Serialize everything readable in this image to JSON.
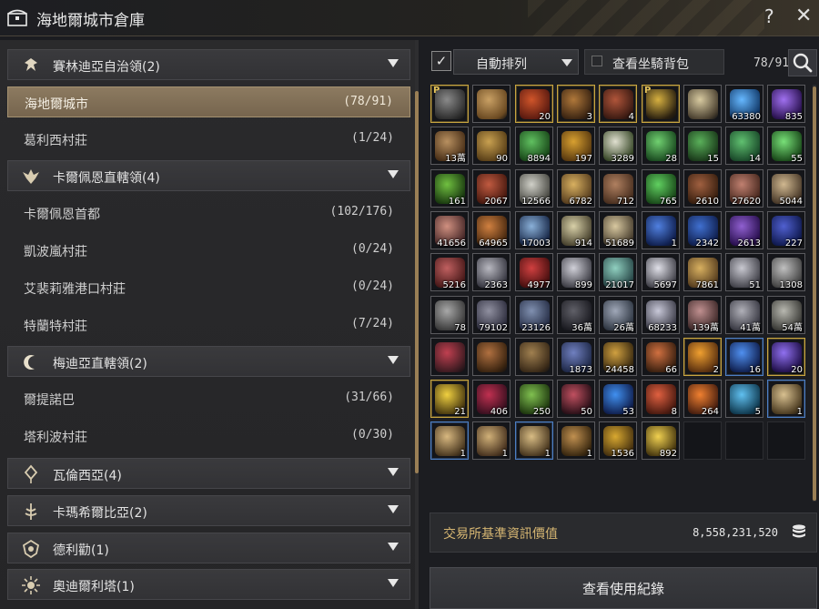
{
  "window": {
    "title": "海地爾城市倉庫",
    "help_label": "?",
    "close_label": "✕"
  },
  "left": {
    "rows": [
      {
        "kind": "region",
        "label": "賽林迪亞自治領(2)",
        "icon": "eagle-emblem-icon"
      },
      {
        "kind": "town",
        "label": "海地爾城市",
        "count": "(78/91)",
        "selected": true
      },
      {
        "kind": "town",
        "label": "葛利西村莊",
        "count": "(1/24)"
      },
      {
        "kind": "region",
        "label": "卡爾佩恩直轄領(4)",
        "icon": "winged-crest-icon"
      },
      {
        "kind": "town",
        "label": "卡爾佩恩首都",
        "count": "(102/176)"
      },
      {
        "kind": "town",
        "label": "凱波嵐村莊",
        "count": "(0/24)"
      },
      {
        "kind": "town",
        "label": "艾裴莉雅港口村莊",
        "count": "(0/24)"
      },
      {
        "kind": "town",
        "label": "特蘭特村莊",
        "count": "(7/24)"
      },
      {
        "kind": "region",
        "label": "梅迪亞直轄領(2)",
        "icon": "crescent-moon-icon"
      },
      {
        "kind": "town",
        "label": "爾提諾巴",
        "count": "(31/66)"
      },
      {
        "kind": "town",
        "label": "塔利波村莊",
        "count": "(0/30)"
      },
      {
        "kind": "region",
        "label": "瓦倫西亞(4)",
        "icon": "diamond-crest-icon"
      },
      {
        "kind": "region",
        "label": "卡瑪希爾比亞(2)",
        "icon": "tree-crest-icon"
      },
      {
        "kind": "region",
        "label": "德利勸(1)",
        "icon": "shield-crest-icon"
      },
      {
        "kind": "region",
        "label": "奧迪爾利塔(1)",
        "icon": "sun-crest-icon"
      }
    ]
  },
  "right": {
    "sort_checked": "✓",
    "sort_label": "自動排列",
    "mount_label": "查看坐騎背包",
    "capacity": "78/91",
    "grid_columns": 9,
    "grid_rows": 10,
    "items": [
      {
        "name": "grapple-hook-item",
        "count": "",
        "q": "gold",
        "c1": "#8a8a8a",
        "c2": "#2c2c2c",
        "p": "P"
      },
      {
        "name": "ornate-sphere-item",
        "count": "",
        "q": "",
        "c1": "#c9a064",
        "c2": "#6b4a22"
      },
      {
        "name": "red-figurine-item",
        "count": "20",
        "q": "gold",
        "c1": "#d0552a",
        "c2": "#5a1a10"
      },
      {
        "name": "bronze-cauldron-item",
        "count": "3",
        "q": "gold",
        "c1": "#b0783a",
        "c2": "#3a2412"
      },
      {
        "name": "red-cauldron-item",
        "count": "4",
        "q": "gold",
        "c1": "#b0553a",
        "c2": "#3a1a12"
      },
      {
        "name": "gold-chandelier-item",
        "count": "",
        "q": "gold",
        "c1": "#d6b040",
        "c2": "#2a2010",
        "p": "P"
      },
      {
        "name": "paper-bundle-item",
        "count": "",
        "q": "",
        "c1": "#d8caa0",
        "c2": "#4a4030"
      },
      {
        "name": "blue-crystal-item",
        "count": "63380",
        "q": "",
        "c1": "#66b8ff",
        "c2": "#123a6a"
      },
      {
        "name": "purple-orb-item",
        "count": "835",
        "q": "",
        "c1": "#a070f0",
        "c2": "#2a1250"
      },
      {
        "name": "brown-grain-item",
        "count": "13萬",
        "q": "",
        "c1": "#b89060",
        "c2": "#4a3018"
      },
      {
        "name": "potato-item",
        "count": "90",
        "q": "",
        "c1": "#c8a050",
        "c2": "#5a4018"
      },
      {
        "name": "green-herb-item",
        "count": "8894",
        "q": "",
        "c1": "#60c060",
        "c2": "#1a4a1a"
      },
      {
        "name": "golden-horn-item",
        "count": "197",
        "q": "",
        "c1": "#d8a030",
        "c2": "#5a3a10"
      },
      {
        "name": "white-flower-item",
        "count": "3289",
        "q": "",
        "c1": "#e0e0d0",
        "c2": "#3a4a2a"
      },
      {
        "name": "green-leaf-item",
        "count": "28",
        "q": "",
        "c1": "#70d070",
        "c2": "#1a4a20"
      },
      {
        "name": "green-moss-item",
        "count": "15",
        "q": "",
        "c1": "#5ab05a",
        "c2": "#1a3a1a"
      },
      {
        "name": "green-slime-item",
        "count": "14",
        "q": "",
        "c1": "#60c070",
        "c2": "#1a4a2a"
      },
      {
        "name": "green-sparkle-item",
        "count": "55",
        "q": "",
        "c1": "#78e078",
        "c2": "#1a4a1a"
      },
      {
        "name": "green-cherry-item",
        "count": "161",
        "q": "",
        "c1": "#70c040",
        "c2": "#1a3a10"
      },
      {
        "name": "red-log-item",
        "count": "2067",
        "q": "",
        "c1": "#c05a40",
        "c2": "#4a1a10"
      },
      {
        "name": "white-bark-item",
        "count": "12566",
        "q": "",
        "c1": "#d0d0c8",
        "c2": "#4a4a44"
      },
      {
        "name": "yellow-branch-item",
        "count": "6782",
        "q": "",
        "c1": "#d8b060",
        "c2": "#5a4020"
      },
      {
        "name": "brown-wood-item",
        "count": "712",
        "q": "",
        "c1": "#b08060",
        "c2": "#4a3020"
      },
      {
        "name": "green-gem-item",
        "count": "765",
        "q": "",
        "c1": "#60d060",
        "c2": "#1a4a1a"
      },
      {
        "name": "brown-stump-item",
        "count": "2610",
        "q": "",
        "c1": "#a06040",
        "c2": "#3a2010"
      },
      {
        "name": "pink-log-item",
        "count": "27620",
        "q": "",
        "c1": "#c08070",
        "c2": "#4a2a20"
      },
      {
        "name": "tan-pile-item",
        "count": "5044",
        "q": "",
        "c1": "#d0b890",
        "c2": "#4a3a2a"
      },
      {
        "name": "pink-sand-item",
        "count": "41656",
        "q": "",
        "c1": "#d09080",
        "c2": "#4a2a2a"
      },
      {
        "name": "orange-sand-item",
        "count": "64965",
        "q": "",
        "c1": "#d08040",
        "c2": "#4a2a10"
      },
      {
        "name": "blue-powder-item",
        "count": "17003",
        "q": "",
        "c1": "#8ab0d8",
        "c2": "#1a2a4a"
      },
      {
        "name": "pale-plank-item",
        "count": "914",
        "q": "",
        "c1": "#d8d0a8",
        "c2": "#4a4430"
      },
      {
        "name": "beige-plank-item",
        "count": "51689",
        "q": "",
        "c1": "#d8c8a0",
        "c2": "#4a4030"
      },
      {
        "name": "blue-shard-item",
        "count": "1",
        "q": "",
        "c1": "#5080e0",
        "c2": "#102050"
      },
      {
        "name": "cobalt-shard-item",
        "count": "2342",
        "q": "",
        "c1": "#4070d0",
        "c2": "#102050"
      },
      {
        "name": "violet-shard-item",
        "count": "2613",
        "q": "",
        "c1": "#9060d0",
        "c2": "#2a1050"
      },
      {
        "name": "indigo-shard-item",
        "count": "227",
        "q": "",
        "c1": "#5060d0",
        "c2": "#101a50"
      },
      {
        "name": "red-ore-item",
        "count": "5216",
        "q": "",
        "c1": "#c06060",
        "c2": "#4a1a1a"
      },
      {
        "name": "silver-ore-item",
        "count": "2363",
        "q": "",
        "c1": "#b8b8c0",
        "c2": "#3a3a44"
      },
      {
        "name": "ruby-ore-item",
        "count": "4977",
        "q": "",
        "c1": "#d04040",
        "c2": "#4a1010"
      },
      {
        "name": "platinum-ore-item",
        "count": "899",
        "q": "",
        "c1": "#d0d0d8",
        "c2": "#404048"
      },
      {
        "name": "opal-ore-item",
        "count": "21017",
        "q": "",
        "c1": "#90d0c0",
        "c2": "#2a4a4a"
      },
      {
        "name": "crystal-ore-item",
        "count": "5697",
        "q": "",
        "c1": "#e0e0e8",
        "c2": "#44444c"
      },
      {
        "name": "gold-ingot-item",
        "count": "7861",
        "q": "",
        "c1": "#d8b060",
        "c2": "#5a4020"
      },
      {
        "name": "silver-ingot-item",
        "count": "51",
        "q": "",
        "c1": "#c8c8d0",
        "c2": "#44444c"
      },
      {
        "name": "stone-pile-item",
        "count": "1308",
        "q": "",
        "c1": "#c0c0c0",
        "c2": "#444444"
      },
      {
        "name": "grey-stone-item",
        "count": "78",
        "q": "",
        "c1": "#a8a8a8",
        "c2": "#3a3a3a"
      },
      {
        "name": "slate-stone-item",
        "count": "79102",
        "q": "",
        "c1": "#9090a0",
        "c2": "#303040"
      },
      {
        "name": "blue-stone-item",
        "count": "23126",
        "q": "",
        "c1": "#8090b0",
        "c2": "#283048"
      },
      {
        "name": "black-stone-item",
        "count": "36萬",
        "q": "",
        "c1": "#606068",
        "c2": "#1a1a20"
      },
      {
        "name": "steel-shard-item",
        "count": "26萬",
        "q": "",
        "c1": "#a0a8b8",
        "c2": "#303844"
      },
      {
        "name": "pale-shard-item",
        "count": "68233",
        "q": "",
        "c1": "#c8c8d8",
        "c2": "#40404c"
      },
      {
        "name": "rose-shard-item",
        "count": "139萬",
        "q": "",
        "c1": "#c09090",
        "c2": "#402a2a"
      },
      {
        "name": "grey-shard-item",
        "count": "41萬",
        "q": "",
        "c1": "#b0b0b8",
        "c2": "#3a3a44"
      },
      {
        "name": "ash-shard-item",
        "count": "54萬",
        "q": "",
        "c1": "#b8b8b0",
        "c2": "#3a3a36"
      },
      {
        "name": "heart-tools-item",
        "count": "",
        "q": "",
        "c1": "#c04050",
        "c2": "#3a1a20"
      },
      {
        "name": "treasure-crate-item",
        "count": "",
        "q": "",
        "c1": "#b07040",
        "c2": "#3a2410"
      },
      {
        "name": "wood-crate-item",
        "count": "",
        "q": "",
        "c1": "#a08050",
        "c2": "#3a2a18"
      },
      {
        "name": "blue-pouch-item",
        "count": "1873",
        "q": "",
        "c1": "#7080c0",
        "c2": "#202a4a"
      },
      {
        "name": "gem-basket-item",
        "count": "24458",
        "q": "",
        "c1": "#d0a040",
        "c2": "#3a2a10"
      },
      {
        "name": "fruit-basket-item",
        "count": "66",
        "q": "",
        "c1": "#d07040",
        "c2": "#3a2010"
      },
      {
        "name": "amber-crystal-item",
        "count": "2",
        "q": "gold",
        "c1": "#f0a030",
        "c2": "#5a3010"
      },
      {
        "name": "sapphire-crystal-item",
        "count": "16",
        "q": "blue",
        "c1": "#5090f0",
        "c2": "#102050"
      },
      {
        "name": "amethyst-crystal-item",
        "count": "20",
        "q": "gold",
        "c1": "#9070f0",
        "c2": "#20104a"
      },
      {
        "name": "yellow-crystal-item",
        "count": "21",
        "q": "gold",
        "c1": "#f0d040",
        "c2": "#4a3a10"
      },
      {
        "name": "crimson-ring-item",
        "count": "406",
        "q": "",
        "c1": "#c03050",
        "c2": "#3a1020"
      },
      {
        "name": "green-spiral-item",
        "count": "250",
        "q": "",
        "c1": "#80c050",
        "c2": "#203a10"
      },
      {
        "name": "black-wing-item",
        "count": "50",
        "q": "",
        "c1": "#c05060",
        "c2": "#2a1018"
      },
      {
        "name": "blue-vortex-item",
        "count": "53",
        "q": "",
        "c1": "#4090f0",
        "c2": "#102050"
      },
      {
        "name": "fire-orb-item",
        "count": "8",
        "q": "",
        "c1": "#e06040",
        "c2": "#4a1a10"
      },
      {
        "name": "ember-orb-item",
        "count": "264",
        "q": "",
        "c1": "#f08030",
        "c2": "#4a2010"
      },
      {
        "name": "ice-orb-item",
        "count": "5",
        "q": "",
        "c1": "#60c0f0",
        "c2": "#103a50"
      },
      {
        "name": "map-fragment-item",
        "count": "1",
        "q": "blue",
        "c1": "#d8c090",
        "c2": "#4a3a20"
      },
      {
        "name": "old-map-item",
        "count": "1",
        "q": "blue",
        "c1": "#d8b880",
        "c2": "#4a3820"
      },
      {
        "name": "torn-map-item",
        "count": "1",
        "q": "",
        "c1": "#d0b078",
        "c2": "#4a3420"
      },
      {
        "name": "map-piece-item",
        "count": "1",
        "q": "blue",
        "c1": "#d8bc84",
        "c2": "#4a3820"
      },
      {
        "name": "potato-crate-item",
        "count": "1",
        "q": "",
        "c1": "#c09050",
        "c2": "#3a2810"
      },
      {
        "name": "gold-coin-item",
        "count": "1536",
        "q": "",
        "c1": "#d8a830",
        "c2": "#4a3410"
      },
      {
        "name": "gold-feather-item",
        "count": "892",
        "q": "",
        "c1": "#f0d050",
        "c2": "#4a3a10"
      }
    ]
  },
  "footer": {
    "value_label": "交易所基準資訊價值",
    "value_amount": "8,558,231,520",
    "history_label": "查看使用紀錄"
  }
}
